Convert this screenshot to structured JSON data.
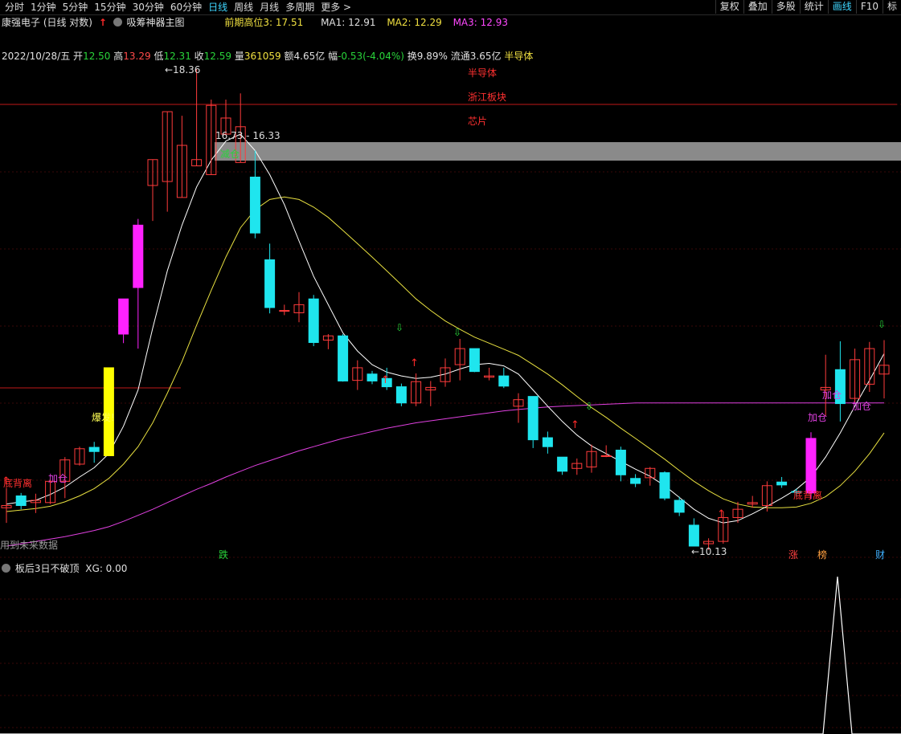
{
  "toolbar": {
    "left": [
      "分时",
      "1分钟",
      "5分钟",
      "15分钟",
      "30分钟",
      "60分钟",
      "日线",
      "周线",
      "月线",
      "多周期",
      "更多 >"
    ],
    "active_left": "日线",
    "right": [
      "复权",
      "叠加",
      "多股",
      "统计",
      "画线",
      "F10",
      "标"
    ],
    "active_right": "画线"
  },
  "title_row": {
    "stock": "康强电子 (日线 对数)",
    "indicator_name": "吸筹神器主图",
    "prev_high": "前期高位3: 17.51",
    "ma1": "MA1: 12.91",
    "ma2": "MA2: 12.29",
    "ma3": "MA3: 12.93"
  },
  "info_row": {
    "date": "2022/10/28/五",
    "open_label": "开",
    "open": "12.50",
    "high_label": "高",
    "high": "13.29",
    "low_label": "低",
    "low": "12.31",
    "close_label": "收",
    "close": "12.59",
    "vol_label": "量",
    "vol": "361059",
    "amt": "额4.65亿",
    "chg_label": "幅",
    "chg": "-0.53(-4.04%)",
    "turnover": "换9.89%",
    "float": "流通3.65亿",
    "sector": "半导体"
  },
  "sector_tags": [
    "半导体",
    "浙江板块",
    "芯片"
  ],
  "annotations": {
    "high_price": "18.36",
    "range_price": "16.73 - 16.33",
    "low_price": "10.13",
    "bottom_divergence": "底背离",
    "add_position": "加仓",
    "reduce_position": "减仓",
    "breakout": "爆发!",
    "future_data": "用到未来数据",
    "fall_tag": "跌",
    "badge_zhang": "涨",
    "badge_bang": "榜",
    "badge_cai": "财"
  },
  "indicator": {
    "name": "板后3日不破顶",
    "value": "XG: 0.00"
  },
  "colors": {
    "up": "#ff3b3b",
    "down": "#1fe5ee",
    "ma1": "#ffffff",
    "ma2": "#e8e040",
    "ma3": "#e040e0",
    "magenta_candle": "#ff22ff",
    "yellow_candle": "#ffff00",
    "band": "#8a8a8a"
  },
  "chart_data": {
    "type": "candlestick",
    "scale": "log",
    "ylim": [
      10.0,
      19.3
    ],
    "candles": [
      {
        "o": 10.5,
        "h": 10.77,
        "l": 10.3,
        "c": 10.53,
        "t": "up"
      },
      {
        "o": 10.66,
        "h": 10.7,
        "l": 10.48,
        "c": 10.53,
        "t": "down"
      },
      {
        "o": 10.6,
        "h": 10.69,
        "l": 10.43,
        "c": 10.57,
        "t": "up"
      },
      {
        "o": 10.57,
        "h": 10.88,
        "l": 10.55,
        "c": 10.86,
        "t": "up"
      },
      {
        "o": 10.86,
        "h": 11.2,
        "l": 10.63,
        "c": 11.16,
        "t": "up"
      },
      {
        "o": 11.1,
        "h": 11.35,
        "l": 11.08,
        "c": 11.32,
        "t": "up"
      },
      {
        "o": 11.34,
        "h": 11.42,
        "l": 11.12,
        "c": 11.28,
        "t": "down"
      },
      {
        "o": 11.22,
        "h": 12.55,
        "l": 11.26,
        "c": 12.55,
        "t": "yellow"
      },
      {
        "o": 13.1,
        "h": 13.7,
        "l": 12.95,
        "c": 13.7,
        "t": "magenta"
      },
      {
        "o": 13.9,
        "h": 15.17,
        "l": 12.86,
        "c": 15.05,
        "t": "magenta"
      },
      {
        "o": 15.83,
        "h": 15.78,
        "l": 15.13,
        "c": 16.36,
        "t": "up"
      },
      {
        "o": 15.91,
        "h": 16.42,
        "l": 15.31,
        "c": 17.39,
        "t": "up"
      },
      {
        "o": 15.59,
        "h": 17.3,
        "l": 15.76,
        "c": 16.66,
        "t": "up"
      },
      {
        "o": 16.23,
        "h": 18.36,
        "l": 16.44,
        "c": 16.36,
        "t": "up"
      },
      {
        "o": 16.05,
        "h": 17.66,
        "l": 16.4,
        "c": 17.53,
        "t": "up"
      },
      {
        "o": 16.9,
        "h": 17.66,
        "l": 17.14,
        "c": 17.25,
        "t": "up"
      },
      {
        "o": 16.3,
        "h": 17.8,
        "l": 17.17,
        "c": 17.06,
        "t": "up"
      },
      {
        "o": 16.0,
        "h": 16.55,
        "l": 14.8,
        "c": 14.9,
        "t": "down"
      },
      {
        "o": 14.4,
        "h": 14.7,
        "l": 13.45,
        "c": 13.55,
        "t": "down"
      },
      {
        "o": 13.5,
        "h": 13.6,
        "l": 13.42,
        "c": 13.5,
        "t": "up"
      },
      {
        "o": 13.6,
        "h": 13.82,
        "l": 13.3,
        "c": 13.46,
        "t": "up"
      },
      {
        "o": 13.7,
        "h": 13.77,
        "l": 12.9,
        "c": 12.96,
        "t": "down"
      },
      {
        "o": 13.0,
        "h": 13.1,
        "l": 12.85,
        "c": 13.07,
        "t": "up"
      },
      {
        "o": 13.07,
        "h": 13.1,
        "l": 12.33,
        "c": 12.34,
        "t": "down"
      },
      {
        "o": 12.35,
        "h": 12.67,
        "l": 12.2,
        "c": 12.55,
        "t": "up"
      },
      {
        "o": 12.45,
        "h": 12.5,
        "l": 12.29,
        "c": 12.34,
        "t": "down"
      },
      {
        "o": 12.38,
        "h": 12.55,
        "l": 12.2,
        "c": 12.25,
        "t": "down"
      },
      {
        "o": 12.25,
        "h": 12.3,
        "l": 11.95,
        "c": 12.0,
        "t": "down"
      },
      {
        "o": 12.0,
        "h": 12.46,
        "l": 11.95,
        "c": 12.33,
        "t": "up"
      },
      {
        "o": 12.2,
        "h": 12.34,
        "l": 11.95,
        "c": 12.24,
        "t": "up"
      },
      {
        "o": 12.33,
        "h": 12.7,
        "l": 12.25,
        "c": 12.55,
        "t": "up"
      },
      {
        "o": 12.6,
        "h": 13.02,
        "l": 12.35,
        "c": 12.86,
        "t": "up"
      },
      {
        "o": 12.86,
        "h": 12.84,
        "l": 12.48,
        "c": 12.49,
        "t": "down"
      },
      {
        "o": 12.4,
        "h": 12.55,
        "l": 12.35,
        "c": 12.42,
        "t": "up"
      },
      {
        "o": 12.42,
        "h": 12.55,
        "l": 12.23,
        "c": 12.26,
        "t": "down"
      },
      {
        "o": 12.05,
        "h": 12.15,
        "l": 11.7,
        "c": 11.95,
        "t": "up"
      },
      {
        "o": 12.1,
        "h": 12.1,
        "l": 11.33,
        "c": 11.45,
        "t": "down"
      },
      {
        "o": 11.48,
        "h": 11.57,
        "l": 11.25,
        "c": 11.35,
        "t": "down"
      },
      {
        "o": 11.2,
        "h": 11.2,
        "l": 10.95,
        "c": 11.0,
        "t": "down"
      },
      {
        "o": 11.11,
        "h": 11.18,
        "l": 10.95,
        "c": 11.04,
        "t": "up"
      },
      {
        "o": 11.06,
        "h": 11.38,
        "l": 10.98,
        "c": 11.28,
        "t": "up"
      },
      {
        "o": 11.22,
        "h": 11.37,
        "l": 11.2,
        "c": 11.22,
        "t": "up"
      },
      {
        "o": 11.3,
        "h": 11.35,
        "l": 10.86,
        "c": 10.95,
        "t": "down"
      },
      {
        "o": 10.9,
        "h": 10.96,
        "l": 10.78,
        "c": 10.83,
        "t": "down"
      },
      {
        "o": 10.91,
        "h": 11.06,
        "l": 10.8,
        "c": 11.04,
        "t": "up"
      },
      {
        "o": 10.98,
        "h": 11.0,
        "l": 10.6,
        "c": 10.63,
        "t": "down"
      },
      {
        "o": 10.6,
        "h": 10.65,
        "l": 10.39,
        "c": 10.44,
        "t": "down"
      },
      {
        "o": 10.27,
        "h": 10.36,
        "l": 10.0,
        "c": 10.0,
        "t": "down"
      },
      {
        "o": 10.03,
        "h": 10.1,
        "l": 9.95,
        "c": 10.06,
        "t": "up"
      },
      {
        "o": 10.06,
        "h": 10.45,
        "l": 10.03,
        "c": 10.37,
        "t": "up"
      },
      {
        "o": 10.37,
        "h": 10.58,
        "l": 10.3,
        "c": 10.48,
        "t": "up"
      },
      {
        "o": 10.55,
        "h": 10.66,
        "l": 10.5,
        "c": 10.57,
        "t": "up"
      },
      {
        "o": 10.53,
        "h": 10.86,
        "l": 10.45,
        "c": 10.8,
        "t": "up"
      },
      {
        "o": 10.85,
        "h": 10.92,
        "l": 10.77,
        "c": 10.81,
        "t": "down"
      },
      {
        "o": 10.71,
        "h": 10.76,
        "l": 10.65,
        "c": 10.72,
        "t": "down"
      },
      {
        "o": 10.7,
        "h": 11.56,
        "l": 10.62,
        "c": 11.47,
        "t": "magenta"
      },
      {
        "o": 12.2,
        "h": 12.76,
        "l": 11.8,
        "c": 12.24,
        "t": "up"
      },
      {
        "o": 11.99,
        "h": 12.98,
        "l": 11.72,
        "c": 12.52,
        "t": "down"
      },
      {
        "o": 12.07,
        "h": 12.86,
        "l": 12.01,
        "c": 12.68,
        "t": "up"
      },
      {
        "o": 12.29,
        "h": 12.97,
        "l": 12.17,
        "c": 12.86,
        "t": "up"
      },
      {
        "o": 12.45,
        "h": 13.0,
        "l": 12.07,
        "c": 12.59,
        "t": "up"
      }
    ],
    "ma1": [
      10.55,
      10.58,
      10.6,
      10.68,
      10.78,
      10.92,
      11.05,
      11.25,
      11.65,
      12.2,
      13.2,
      14.2,
      15.05,
      15.8,
      16.35,
      16.75,
      16.9,
      16.55,
      16.05,
      15.45,
      14.75,
      14.1,
      13.6,
      13.12,
      12.82,
      12.6,
      12.48,
      12.42,
      12.38,
      12.4,
      12.45,
      12.53,
      12.6,
      12.62,
      12.58,
      12.45,
      12.2,
      11.95,
      11.72,
      11.52,
      11.36,
      11.25,
      11.14,
      11.03,
      10.93,
      10.8,
      10.64,
      10.48,
      10.36,
      10.3,
      10.33,
      10.42,
      10.52,
      10.63,
      10.75,
      10.92,
      11.2,
      11.55,
      11.95,
      12.35,
      12.78
    ],
    "ma2": [
      10.45,
      10.47,
      10.49,
      10.52,
      10.58,
      10.66,
      10.76,
      10.9,
      11.1,
      11.35,
      11.7,
      12.15,
      12.65,
      13.25,
      13.85,
      14.45,
      15.0,
      15.35,
      15.55,
      15.6,
      15.55,
      15.4,
      15.2,
      14.95,
      14.7,
      14.45,
      14.2,
      13.95,
      13.7,
      13.5,
      13.32,
      13.18,
      13.05,
      12.95,
      12.85,
      12.75,
      12.6,
      12.45,
      12.28,
      12.1,
      11.93,
      11.78,
      11.62,
      11.47,
      11.32,
      11.17,
      11.01,
      10.86,
      10.73,
      10.62,
      10.55,
      10.51,
      10.5,
      10.5,
      10.51,
      10.56,
      10.65,
      10.8,
      11.0,
      11.25,
      11.55
    ],
    "ma3": [
      10.0,
      10.03,
      10.06,
      10.09,
      10.12,
      10.16,
      10.2,
      10.25,
      10.32,
      10.4,
      10.48,
      10.57,
      10.66,
      10.75,
      10.83,
      10.92,
      11.0,
      11.08,
      11.15,
      11.22,
      11.29,
      11.35,
      11.41,
      11.47,
      11.52,
      11.57,
      11.62,
      11.66,
      11.7,
      11.73,
      11.76,
      11.79,
      11.82,
      11.85,
      11.88,
      11.9,
      11.92,
      11.94,
      11.95,
      11.96,
      11.97,
      11.98,
      11.99,
      12.0,
      12.0,
      12.0,
      12.0,
      12.0,
      12.0,
      12.0,
      12.0,
      12.0,
      12.0,
      12.0,
      12.0,
      12.0,
      12.0,
      12.0,
      12.0,
      12.0,
      12.0
    ]
  }
}
